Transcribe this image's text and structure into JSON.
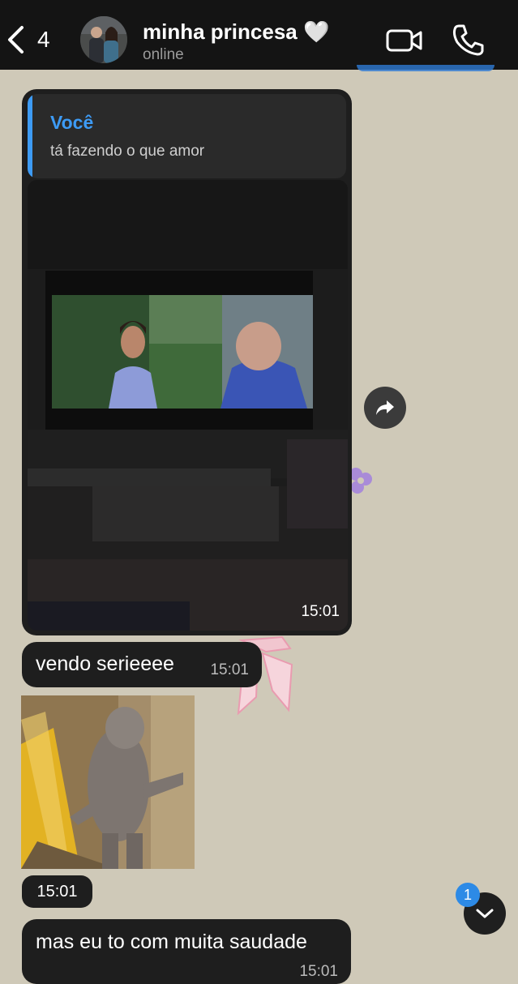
{
  "header": {
    "back_count": "4",
    "contact_name": "minha princesa 🤍",
    "status": "online"
  },
  "messages": {
    "media": {
      "quote_author": "Você",
      "quote_text": "tá fazendo o que amor",
      "time": "15:01"
    },
    "text1": {
      "text": "vendo serieeee",
      "time": "15:01"
    },
    "sticker": {
      "time": "15:01"
    },
    "text2": {
      "text": "mas eu to com muita saudade",
      "time": "15:01"
    }
  },
  "unread_count": "1",
  "colors": {
    "accent": "#3d9bf5",
    "bubble": "#1e1e1e",
    "header": "#141414",
    "wallpaper": "#cfc9b8",
    "badge": "#2d8ae6"
  },
  "icons": [
    "back-chevron-icon",
    "video-call-icon",
    "phone-icon",
    "forward-icon",
    "chevron-down-icon"
  ]
}
